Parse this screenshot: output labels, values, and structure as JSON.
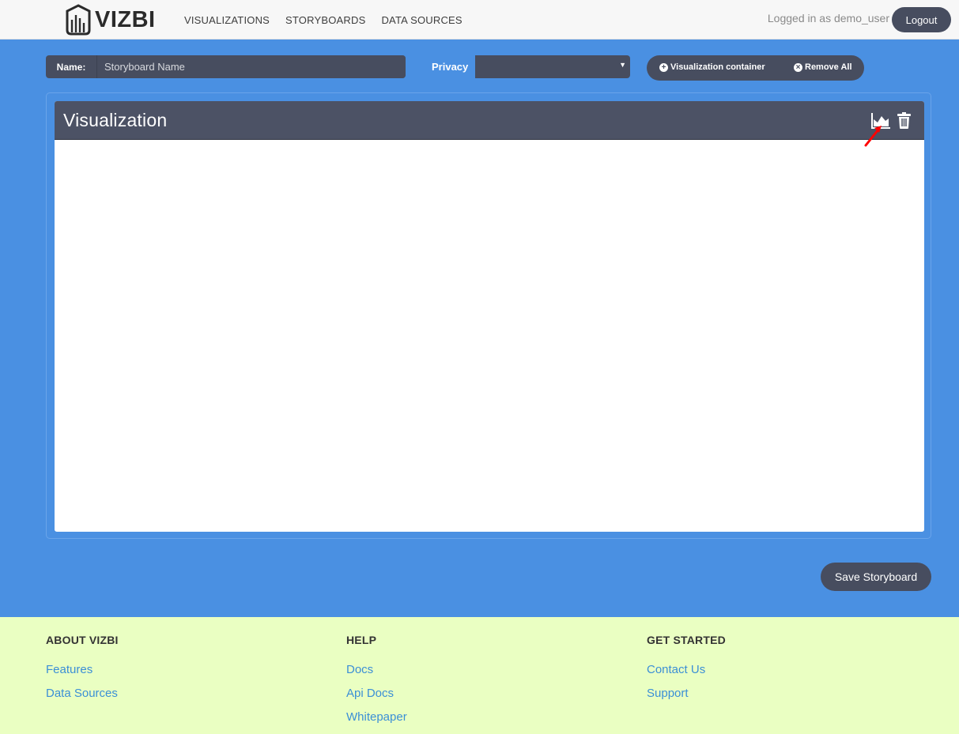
{
  "brand": {
    "name": "VIZBI"
  },
  "nav": {
    "items": [
      {
        "label": "VISUALIZATIONS"
      },
      {
        "label": "STORYBOARDS"
      },
      {
        "label": "DATA SOURCES"
      }
    ]
  },
  "user": {
    "login_text": "Logged in as demo_user",
    "logout_label": "Logout"
  },
  "toolbar": {
    "name_label": "Name:",
    "name_placeholder": "Storyboard Name",
    "name_value": "",
    "privacy_label": "Privacy",
    "privacy_value": "",
    "add_container_label": "Visualization container",
    "remove_all_label": "Remove All"
  },
  "panel": {
    "title": "Visualization"
  },
  "actions": {
    "save_label": "Save Storyboard"
  },
  "footer": {
    "columns": [
      {
        "heading": "ABOUT VIZBI",
        "links": [
          "Features",
          "Data Sources"
        ]
      },
      {
        "heading": "HELP",
        "links": [
          "Docs",
          "Api Docs",
          "Whitepaper"
        ]
      },
      {
        "heading": "GET STARTED",
        "links": [
          "Contact Us",
          "Support"
        ]
      }
    ]
  },
  "colors": {
    "background": "#4a90e2",
    "dark_control": "#474d5f",
    "footer_bg": "#eaffc2",
    "link": "#3b8fd6",
    "annotation_arrow": "#ff0000"
  },
  "icons": {
    "logo": "vizbi-logo-icon",
    "add": "plus-circle-icon",
    "remove": "times-circle-icon",
    "chart": "area-chart-icon",
    "delete": "trash-icon",
    "select": "caret-down-icon"
  }
}
